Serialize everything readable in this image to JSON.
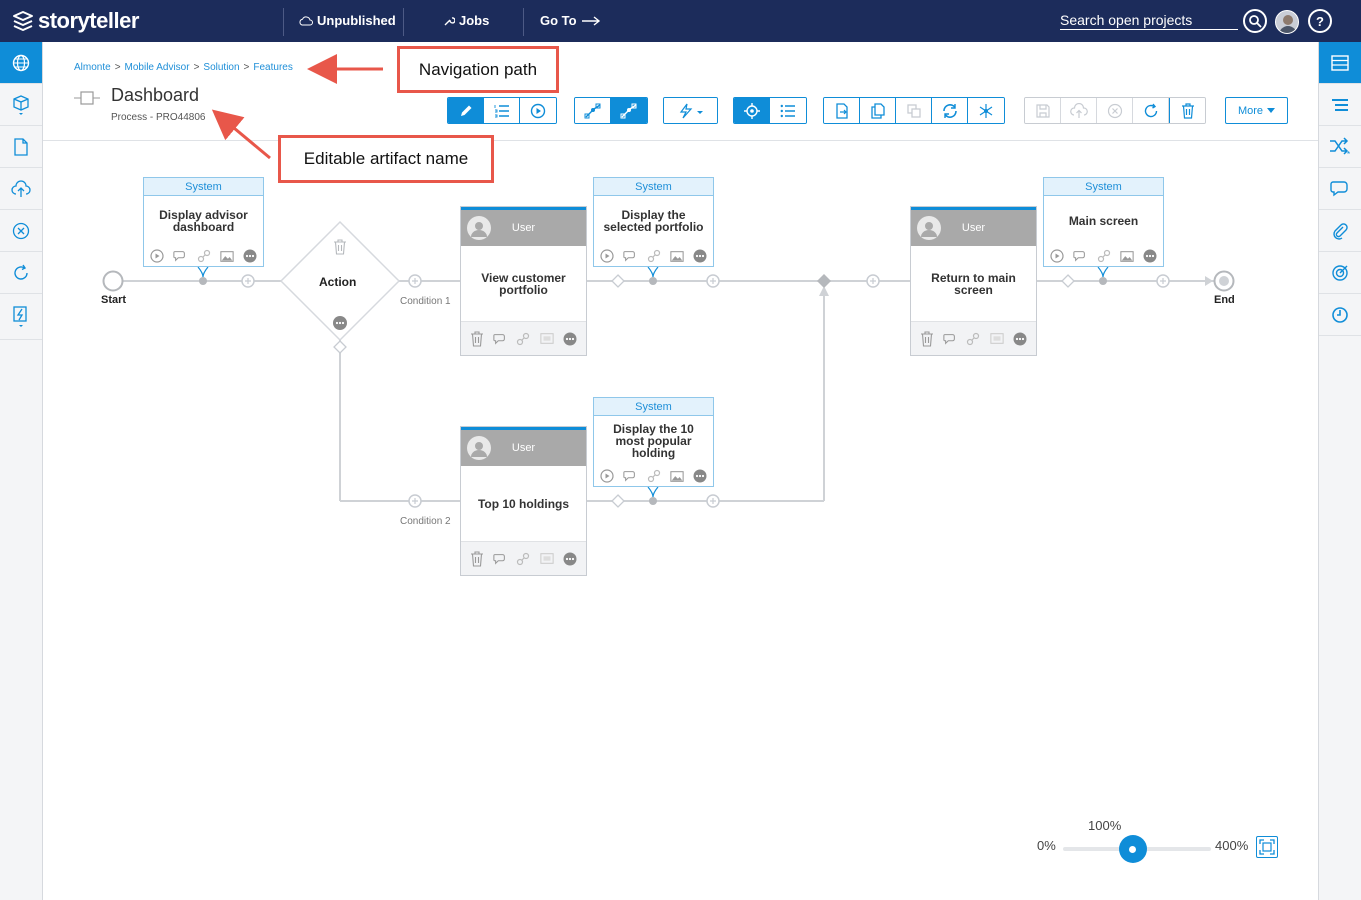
{
  "topbar": {
    "logo": "storyteller",
    "unpublished": "Unpublished",
    "jobs": "Jobs",
    "goto": "Go To",
    "search_placeholder": "Search open projects",
    "help": "?"
  },
  "breadcrumb": [
    "Almonte",
    "Mobile Advisor",
    "Solution",
    "Features"
  ],
  "breadcrumb_sep": ">",
  "artifact": {
    "title": "Dashboard",
    "subtitle": "Process - PRO44806"
  },
  "toolbar": {
    "more_label": "More"
  },
  "annotations": {
    "nav": "Navigation path",
    "editable": "Editable artifact name"
  },
  "process": {
    "start": "Start",
    "end": "End",
    "action": "Action",
    "condition1": "Condition 1",
    "condition2": "Condition 2",
    "system_label": "System",
    "user_label": "User",
    "system_tasks": [
      "Display advisor dashboard",
      "Display the selected portfolio",
      "Main screen",
      "Display the 10 most popular holding"
    ],
    "user_tasks": [
      "View customer portfolio",
      "Return to main screen",
      "Top 10 holdings"
    ]
  },
  "zoom": {
    "min": "0%",
    "current": "100%",
    "max": "400%",
    "value": 1.0
  },
  "colors": {
    "navy": "#1c2c5b",
    "accent": "#0f8dd8",
    "annotation": "#e8574a"
  }
}
